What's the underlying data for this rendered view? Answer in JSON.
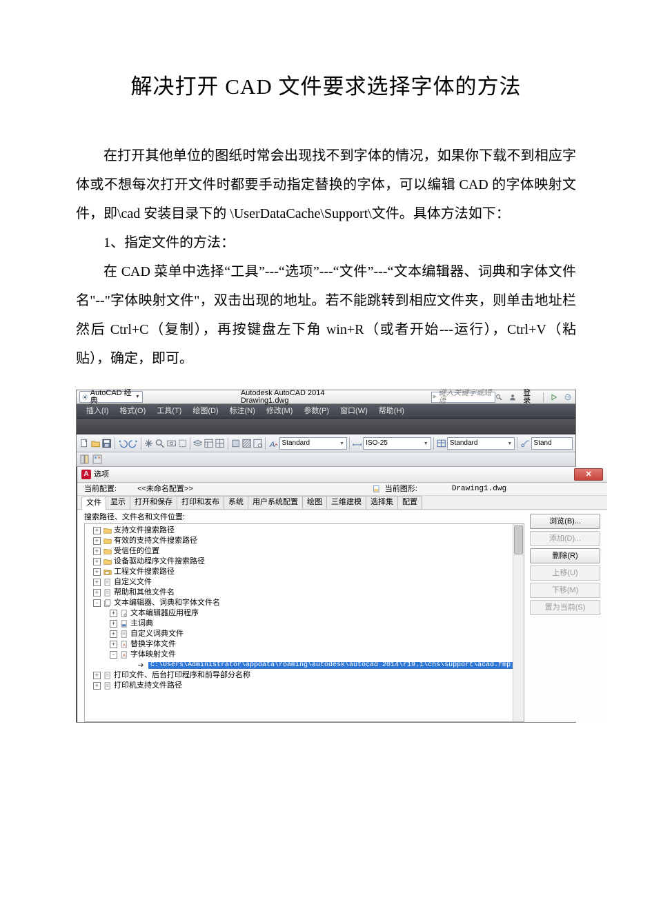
{
  "title": "解决打开 CAD 文件要求选择字体的方法",
  "para1": "在打开其他单位的图纸时常会出现找不到字体的情况，如果你下载不到相应字体或不想每次打开文件时都要手动指定替换的字体，可以编辑 CAD 的字体映射文件，即\\cad 安装目录下的 \\UserDataCache\\Support\\文件。具体方法如下：",
  "para2": "1、指定文件的方法：",
  "para3": "在 CAD 菜单中选择“工具”---“选项”---“文件”---“文本编辑器、词典和字体文件名\"--\"字体映射文件\"，双击出现的地址。若不能跳转到相应文件夹，则单击地址栏然后 Ctrl+C（复制），再按键盘左下角 win+R（或者开始---运行），Ctrl+V（粘贴），确定，即可。",
  "app": {
    "workspace": "AutoCAD 经典",
    "titleText": "Autodesk AutoCAD 2014      Drawing1.dwg",
    "searchPlaceholder": "键入关键字或短语",
    "login": "登录"
  },
  "menus": [
    "插入(I)",
    "格式(O)",
    "工具(T)",
    "绘图(D)",
    "标注(N)",
    "修改(M)",
    "参数(P)",
    "窗口(W)",
    "帮助(H)"
  ],
  "toolbar": {
    "styleA": "Standard",
    "dimStyle": "ISO-25",
    "styleB": "Standard",
    "styleC": "Stand"
  },
  "dialog": {
    "title": "选项",
    "cfgLabel": "当前配置:",
    "cfgValue": "<<未命名配置>>",
    "drawingLabel": "当前图形:",
    "drawingValue": "Drawing1.dwg",
    "tabs": [
      "文件",
      "显示",
      "打开和保存",
      "打印和发布",
      "系统",
      "用户系统配置",
      "绘图",
      "三维建模",
      "选择集",
      "配置"
    ],
    "treeLabel": "搜索路径、文件名和文件位置:",
    "tree": [
      {
        "l": 1,
        "e": "+",
        "icon": "folder",
        "t": "支持文件搜索路径"
      },
      {
        "l": 1,
        "e": "+",
        "icon": "folder",
        "t": "有效的支持文件搜索路径"
      },
      {
        "l": 1,
        "e": "+",
        "icon": "folder",
        "t": "受信任的位置"
      },
      {
        "l": 1,
        "e": "+",
        "icon": "folder",
        "t": "设备驱动程序文件搜索路径"
      },
      {
        "l": 1,
        "e": "+",
        "icon": "folder2",
        "t": "工程文件搜索路径"
      },
      {
        "l": 1,
        "e": "+",
        "icon": "doc",
        "t": "自定义文件"
      },
      {
        "l": 1,
        "e": "+",
        "icon": "doc",
        "t": "帮助和其他文件名"
      },
      {
        "l": 1,
        "e": "-",
        "icon": "stack",
        "t": "文本编辑器、词典和字体文件名"
      },
      {
        "l": 2,
        "e": "+",
        "icon": "docg",
        "t": "文本编辑器应用程序"
      },
      {
        "l": 2,
        "e": "+",
        "icon": "docb",
        "t": "主词典"
      },
      {
        "l": 2,
        "e": "+",
        "icon": "doc",
        "t": "自定义词典文件"
      },
      {
        "l": 2,
        "e": "+",
        "icon": "docf",
        "t": "替换字体文件"
      },
      {
        "l": 2,
        "e": "-",
        "icon": "docf",
        "t": "字体映射文件"
      },
      {
        "l": 3,
        "e": "",
        "icon": "arrow",
        "hl": true,
        "t": "C:\\Users\\Administrator\\appdata\\roaming\\autodesk\\autocad 2014\\r19.1\\chs\\support\\acad.fmp"
      },
      {
        "l": 1,
        "e": "+",
        "icon": "doc",
        "t": "打印文件、后台打印程序和前导部分名称"
      },
      {
        "l": 1,
        "e": "+",
        "icon": "doc",
        "t": "打印机支持文件路径"
      }
    ],
    "buttons": {
      "browse": "浏览(B)...",
      "add": "添加(D)...",
      "remove": "删除(R)",
      "up": "上移(U)",
      "down": "下移(M)",
      "setcur": "置为当前(S)"
    }
  }
}
